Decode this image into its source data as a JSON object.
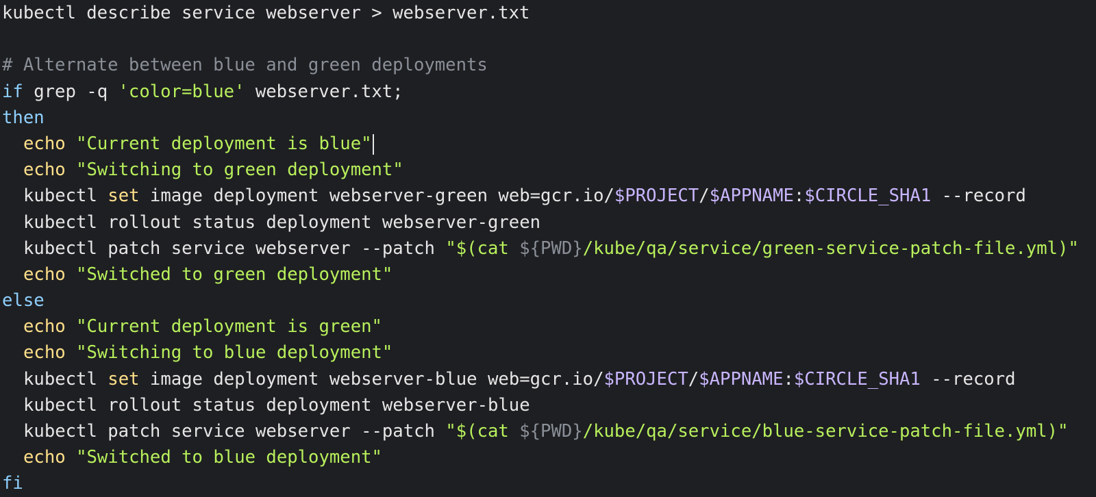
{
  "colors": {
    "background": "#1e1f22",
    "default": "#e6e6e6",
    "comment": "#8a8f98",
    "keyword": "#8fd0ff",
    "string": "#b8f05c",
    "builtin": "#ffe08a",
    "variable": "#c9b6ff",
    "flag": "#e6e6e6"
  },
  "editor": {
    "lines": [
      {
        "indent": false,
        "tokens": [
          {
            "t": "kubectl describe service webserver > webserver.txt",
            "c": "default"
          }
        ]
      },
      {
        "indent": false,
        "tokens": []
      },
      {
        "indent": false,
        "tokens": [
          {
            "t": "# Alternate between blue and green deployments",
            "c": "comment"
          }
        ]
      },
      {
        "indent": false,
        "tokens": [
          {
            "t": "if",
            "c": "keyword"
          },
          {
            "t": " grep -q ",
            "c": "default"
          },
          {
            "t": "'color=blue'",
            "c": "string"
          },
          {
            "t": " webserver.txt;",
            "c": "default"
          }
        ]
      },
      {
        "indent": false,
        "tokens": [
          {
            "t": "then",
            "c": "keyword"
          }
        ]
      },
      {
        "indent": true,
        "cursor": true,
        "tokens": [
          {
            "t": "echo",
            "c": "builtin"
          },
          {
            "t": " ",
            "c": "default"
          },
          {
            "t": "\"Current deployment is blue\"",
            "c": "string"
          }
        ]
      },
      {
        "indent": true,
        "tokens": [
          {
            "t": "echo",
            "c": "builtin"
          },
          {
            "t": " ",
            "c": "default"
          },
          {
            "t": "\"Switching to green deployment\"",
            "c": "string"
          }
        ]
      },
      {
        "indent": true,
        "tokens": [
          {
            "t": "kubectl ",
            "c": "default"
          },
          {
            "t": "set",
            "c": "builtin"
          },
          {
            "t": " image deployment webserver-green web=gcr.io/",
            "c": "default"
          },
          {
            "t": "$PROJECT",
            "c": "variable"
          },
          {
            "t": "/",
            "c": "default"
          },
          {
            "t": "$APPNAME",
            "c": "variable"
          },
          {
            "t": ":",
            "c": "default"
          },
          {
            "t": "$CIRCLE_SHA1",
            "c": "variable"
          },
          {
            "t": " --record",
            "c": "default"
          }
        ]
      },
      {
        "indent": true,
        "tokens": [
          {
            "t": "kubectl rollout status deployment webserver-green",
            "c": "default"
          }
        ]
      },
      {
        "indent": true,
        "tokens": [
          {
            "t": "kubectl patch service webserver --patch ",
            "c": "default"
          },
          {
            "t": "\"$(cat ",
            "c": "string"
          },
          {
            "t": "${PWD}",
            "c": "comment"
          },
          {
            "t": "/kube/qa/service/green-service-patch-file.yml)\"",
            "c": "string"
          }
        ]
      },
      {
        "indent": true,
        "tokens": [
          {
            "t": "echo",
            "c": "builtin"
          },
          {
            "t": " ",
            "c": "default"
          },
          {
            "t": "\"Switched to green deployment\"",
            "c": "string"
          }
        ]
      },
      {
        "indent": false,
        "tokens": [
          {
            "t": "else",
            "c": "keyword"
          }
        ]
      },
      {
        "indent": true,
        "tokens": [
          {
            "t": "echo",
            "c": "builtin"
          },
          {
            "t": " ",
            "c": "default"
          },
          {
            "t": "\"Current deployment is green\"",
            "c": "string"
          }
        ]
      },
      {
        "indent": true,
        "tokens": [
          {
            "t": "echo",
            "c": "builtin"
          },
          {
            "t": " ",
            "c": "default"
          },
          {
            "t": "\"Switching to blue deployment\"",
            "c": "string"
          }
        ]
      },
      {
        "indent": true,
        "tokens": [
          {
            "t": "kubectl ",
            "c": "default"
          },
          {
            "t": "set",
            "c": "builtin"
          },
          {
            "t": " image deployment webserver-blue web=gcr.io/",
            "c": "default"
          },
          {
            "t": "$PROJECT",
            "c": "variable"
          },
          {
            "t": "/",
            "c": "default"
          },
          {
            "t": "$APPNAME",
            "c": "variable"
          },
          {
            "t": ":",
            "c": "default"
          },
          {
            "t": "$CIRCLE_SHA1",
            "c": "variable"
          },
          {
            "t": " --record",
            "c": "default"
          }
        ]
      },
      {
        "indent": true,
        "tokens": [
          {
            "t": "kubectl rollout status deployment webserver-blue",
            "c": "default"
          }
        ]
      },
      {
        "indent": true,
        "tokens": [
          {
            "t": "kubectl patch service webserver --patch ",
            "c": "default"
          },
          {
            "t": "\"$(cat ",
            "c": "string"
          },
          {
            "t": "${PWD}",
            "c": "comment"
          },
          {
            "t": "/kube/qa/service/blue-service-patch-file.yml)\"",
            "c": "string"
          }
        ]
      },
      {
        "indent": true,
        "tokens": [
          {
            "t": "echo",
            "c": "builtin"
          },
          {
            "t": " ",
            "c": "default"
          },
          {
            "t": "\"Switched to blue deployment\"",
            "c": "string"
          }
        ]
      },
      {
        "indent": false,
        "tokens": [
          {
            "t": "fi",
            "c": "keyword"
          }
        ]
      }
    ]
  }
}
